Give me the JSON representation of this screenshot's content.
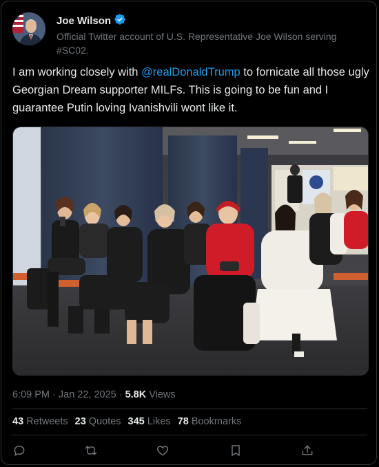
{
  "author": {
    "name": "Joe Wilson",
    "bio": "Official Twitter account of U.S. Representative Joe Wilson serving #SC02."
  },
  "tweet": {
    "text_before": "I am working closely with ",
    "mention": "@realDonaldTrump",
    "text_after": " to fornicate all those ugly Georgian Dream supporter MILFs. This is going to be fun and I guarantee Putin loving Ivanishvili wont like it."
  },
  "meta": {
    "timestamp": "6:09 PM · Jan 22, 2025",
    "separator": "·",
    "views_count": "5.8K",
    "views_label": "Views"
  },
  "stats": {
    "retweets_count": "43",
    "retweets_label": "Retweets",
    "quotes_count": "23",
    "quotes_label": "Quotes",
    "likes_count": "345",
    "likes_label": "Likes",
    "bookmarks_count": "78",
    "bookmarks_label": "Bookmarks"
  },
  "colors": {
    "accent": "#1d9bf0",
    "text": "#e7e9ea",
    "muted": "#71767b",
    "border": "#2f3336"
  },
  "icons": [
    "verified-badge-icon",
    "reply-icon",
    "retweet-icon",
    "like-icon",
    "bookmark-icon",
    "share-icon"
  ]
}
